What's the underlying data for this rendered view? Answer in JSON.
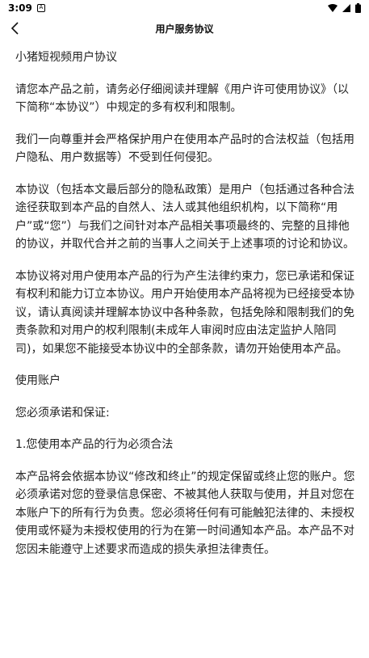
{
  "status": {
    "time": "3:09"
  },
  "header": {
    "title": "用户服务协议"
  },
  "content": {
    "heading": "小猪短视频用户协议",
    "p1": "请您本产品之前，请务必仔细阅读并理解《用户许可使用协议》（以下简称“本协议”）中规定的多有权利和限制。",
    "p2": "我们一向尊重并会严格保护用户在使用本产品时的合法权益（包括用户隐私、用户数据等）不受到任何侵犯。",
    "p3": "本协议（包括本文最后部分的隐私政策）是用户（包括通过各种合法途径获取到本产品的自然人、法人或其他组织机构，以下简称“用户”或“您”）与我们之间针对本产品相关事项最终的、完整的且排他的协议，并取代合并之前的当事人之间关于上述事项的讨论和协议。",
    "p4": "本协议将对用户使用本产品的行为产生法律约束力，您已承诺和保证有权利和能力订立本协议。用户开始使用本产品将视为已经接受本协议，请认真阅读并理解本协议中各种条款，包括免除和限制我们的免责条款和对用户的权利限制(未成年人审阅时应由法定监护人陪同司)，如果您不能接受本协议中的全部条款，请勿开始使用本产品。",
    "section_account": "使用账户",
    "section_promise": "您必须承诺和保证:",
    "item1": "1.您使用本产品的行为必须合法",
    "p5": "本产品将会依据本协议“修改和终止”的规定保留或终止您的账户。您必须承诺对您的登录信息保密、不被其他人获取与使用，并且对您在本账户下的所有行为负责。您必须将任何有可能触犯法律的、未授权使用或怀疑为未授权使用的行为在第一时间通知本产品。本产品不对您因未能遵守上述要求而造成的损失承担法律责任。"
  }
}
